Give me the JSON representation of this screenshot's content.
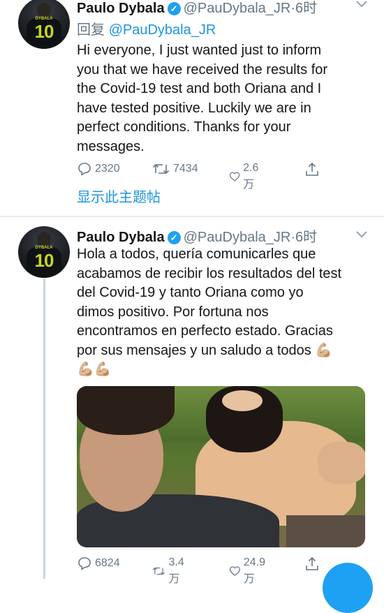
{
  "tweets": [
    {
      "author": {
        "name": "Paulo Dybala",
        "handle": "@PauDybala_JR",
        "time": "6时",
        "separator": "·",
        "avatar_text": "10",
        "avatar_name": "DYBALA"
      },
      "reply_prefix": "回复",
      "reply_to": "@PauDybala_JR",
      "lines": [
        "Hi everyone, I just wanted just  to inform",
        "you that we have received the results for",
        "the Covid-19 test and both Oriana and I",
        "have tested positive. Luckily we are in",
        "perfect conditions. Thanks for your",
        "messages."
      ],
      "stats": {
        "replies": "2320",
        "retweets": "7434",
        "likes": "2.6万"
      },
      "show_thread": "显示此主题帖"
    },
    {
      "author": {
        "name": "Paulo Dybala",
        "handle": "@PauDybala_JR",
        "time": "6时",
        "separator": "·",
        "avatar_text": "10",
        "avatar_name": "DYBALA"
      },
      "lines": [
        "Hola a todos, quería comunicarles que",
        "acabamos de recibir los resultados del test",
        "del Covid-19 y tanto Oriana como yo",
        "dimos positivo. Por fortuna nos",
        "encontramos en perfecto estado. Gracias",
        "por sus mensajes y un saludo a todos 💪🏼",
        "💪🏼💪🏼"
      ],
      "stats": {
        "replies": "6824",
        "retweets": "3.4万",
        "likes": "24.9万"
      }
    }
  ],
  "icons": [
    "verified-icon",
    "caret-down-icon",
    "reply-icon",
    "retweet-icon",
    "like-icon",
    "share-icon"
  ],
  "colors": {
    "accent": "#1da1f2",
    "link": "#1b95e0",
    "muted": "#657786",
    "text": "#14171a",
    "divider": "#e6ecf0"
  }
}
